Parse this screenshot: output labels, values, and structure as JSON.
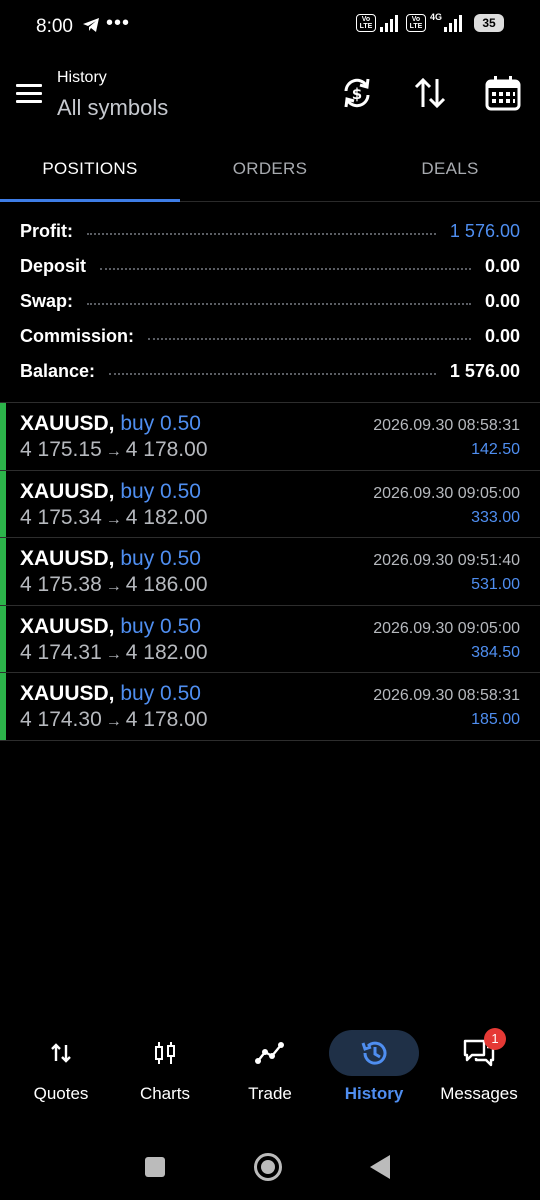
{
  "status_bar": {
    "time": "8:00",
    "dots": "•••",
    "network": "4G",
    "volte": "Vo LTE",
    "battery": "35"
  },
  "header": {
    "title": "History",
    "subtitle": "All symbols"
  },
  "tabs": [
    {
      "label": "POSITIONS",
      "active": true
    },
    {
      "label": "ORDERS",
      "active": false
    },
    {
      "label": "DEALS",
      "active": false
    }
  ],
  "summary": [
    {
      "label": "Profit:",
      "value": "1 576.00",
      "highlight": true
    },
    {
      "label": "Deposit",
      "value": "0.00",
      "highlight": false
    },
    {
      "label": "Swap:",
      "value": "0.00",
      "highlight": false
    },
    {
      "label": "Commission:",
      "value": "0.00",
      "highlight": false
    },
    {
      "label": "Balance:",
      "value": "1 576.00",
      "highlight": false
    }
  ],
  "positions": [
    {
      "symbol": "XAUUSD,",
      "type": "buy 0.50",
      "open": "4 175.15",
      "close": "4 178.00",
      "time": "2026.09.30 08:58:31",
      "profit": "142.50"
    },
    {
      "symbol": "XAUUSD,",
      "type": "buy 0.50",
      "open": "4 175.34",
      "close": "4 182.00",
      "time": "2026.09.30 09:05:00",
      "profit": "333.00"
    },
    {
      "symbol": "XAUUSD,",
      "type": "buy 0.50",
      "open": "4 175.38",
      "close": "4 186.00",
      "time": "2026.09.30 09:51:40",
      "profit": "531.00"
    },
    {
      "symbol": "XAUUSD,",
      "type": "buy 0.50",
      "open": "4 174.31",
      "close": "4 182.00",
      "time": "2026.09.30 09:05:00",
      "profit": "384.50"
    },
    {
      "symbol": "XAUUSD,",
      "type": "buy 0.50",
      "open": "4 174.30",
      "close": "4 178.00",
      "time": "2026.09.30 08:58:31",
      "profit": "185.00"
    }
  ],
  "arrow": "→",
  "bottom_nav": [
    {
      "label": "Quotes",
      "icon": "quotes-icon",
      "active": false
    },
    {
      "label": "Charts",
      "icon": "charts-icon",
      "active": false
    },
    {
      "label": "Trade",
      "icon": "trade-icon",
      "active": false
    },
    {
      "label": "History",
      "icon": "history-icon",
      "active": true
    },
    {
      "label": "Messages",
      "icon": "messages-icon",
      "active": false,
      "badge": "1"
    }
  ],
  "colors": {
    "accent": "#4f8ef0",
    "buy_bar": "#2cb34a",
    "badge": "#e53935"
  }
}
